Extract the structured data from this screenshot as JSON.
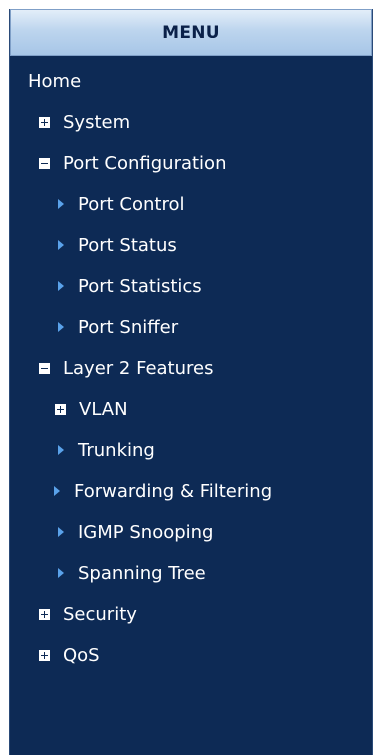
{
  "menu": {
    "title": "MENU",
    "items": [
      {
        "label": "Home",
        "icon": "none"
      },
      {
        "label": "System",
        "icon": "plus-box-icon"
      },
      {
        "label": "Port Configuration",
        "icon": "minus-box-icon"
      },
      {
        "label": "Port Control",
        "icon": "triangle-arrow-icon"
      },
      {
        "label": "Port Status",
        "icon": "triangle-arrow-icon"
      },
      {
        "label": "Port Statistics",
        "icon": "triangle-arrow-icon"
      },
      {
        "label": "Port Sniffer",
        "icon": "triangle-arrow-icon"
      },
      {
        "label": "Layer 2 Features",
        "icon": "minus-box-icon"
      },
      {
        "label": "VLAN",
        "icon": "plus-box-icon"
      },
      {
        "label": "Trunking",
        "icon": "triangle-arrow-icon"
      },
      {
        "label": "Forwarding & Filtering",
        "icon": "triangle-arrow-icon"
      },
      {
        "label": "IGMP Snooping",
        "icon": "triangle-arrow-icon"
      },
      {
        "label": "Spanning Tree",
        "icon": "triangle-arrow-icon"
      },
      {
        "label": "Security",
        "icon": "plus-box-icon"
      },
      {
        "label": "QoS",
        "icon": "plus-box-icon"
      }
    ]
  },
  "colors": {
    "panel_background": "#0d2a55",
    "header_gradient_top": "#e3eef9",
    "header_gradient_bottom": "#a7c6e7",
    "header_text": "#0b2149",
    "item_text": "#ffffff",
    "arrow_accent": "#5aa2ea"
  }
}
